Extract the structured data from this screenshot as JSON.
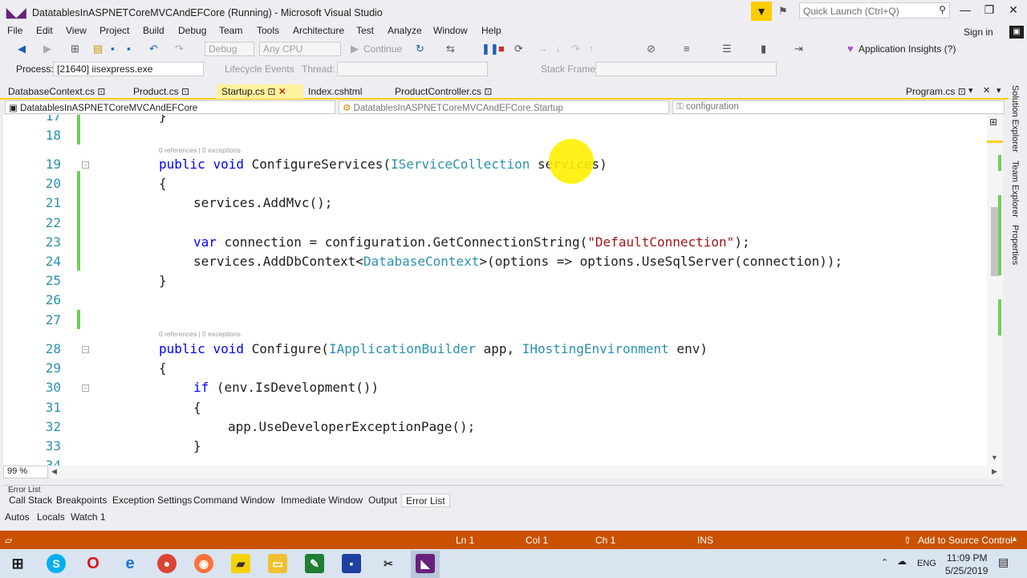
{
  "window": {
    "title": "DatatablesInASPNETCoreMVCAndEFCore (Running) - Microsoft Visual Studio",
    "quick_launch_placeholder": "Quick Launch (Ctrl+Q)",
    "minimize": "—",
    "maximize": "❐",
    "close": "✕"
  },
  "menu": {
    "items": [
      "File",
      "Edit",
      "View",
      "Project",
      "Build",
      "Debug",
      "Team",
      "Tools",
      "Architecture",
      "Test",
      "Analyze",
      "Window",
      "Help"
    ],
    "sign_in": "Sign in"
  },
  "toolbar": {
    "config": "Debug",
    "platform": "Any CPU",
    "continue": "Continue",
    "app_insights": "Application Insights (?)",
    "process_label": "Process:",
    "process_value": "[21640] iisexpress.exe",
    "lifecycle_events": "Lifecycle Events",
    "thread_label": "Thread:",
    "stack_frame_label": "Stack Frame:"
  },
  "tabs": [
    {
      "label": "DatabaseContext.cs",
      "pin": "⊡"
    },
    {
      "label": "Product.cs",
      "pin": "⊡"
    },
    {
      "label": "Startup.cs",
      "pin": "⊡"
    },
    {
      "label": "Index.cshtml",
      "pin": ""
    },
    {
      "label": "ProductController.cs",
      "pin": "⊡"
    },
    {
      "label": "Program.cs",
      "pin": "⊡"
    }
  ],
  "navbar": {
    "project": "DatatablesInASPNETCoreMVCAndEFCore",
    "class": "DatatablesInASPNETCoreMVCAndEFCore.Startup",
    "member": "configuration"
  },
  "editor": {
    "line_numbers": [
      "17",
      "18",
      "19",
      "20",
      "21",
      "22",
      "23",
      "24",
      "25",
      "26",
      "27",
      "28",
      "29",
      "30",
      "31",
      "32",
      "33",
      "34"
    ],
    "codelens": "0 references | 0 exceptions",
    "lines": {
      "l17": "}",
      "l19_kw1": "public",
      "l19_kw2": "void",
      "l19_name": "ConfigureServices(",
      "l19_type": "IServiceCollection",
      "l19_rest": " services)",
      "l20": "{",
      "l21": "services.AddMvc();",
      "l23_kw": "var",
      "l23_a": " connection = configuration.GetConnectionString(",
      "l23_str": "\"DefaultConnection\"",
      "l23_b": ");",
      "l24_a": "services.AddDbContext<",
      "l24_type": "DatabaseContext",
      "l24_b": ">(options => options.UseSqlServer(connection));",
      "l25": "}",
      "l28_kw1": "public",
      "l28_kw2": "void",
      "l28_name": "Configure(",
      "l28_type1": "IApplicationBuilder",
      "l28_mid": " app, ",
      "l28_type2": "IHostingEnvironment",
      "l28_rest": " env)",
      "l29": "{",
      "l30_kw": "if",
      "l30_rest": " (env.IsDevelopment())",
      "l31": "{",
      "l32": "app.UseDeveloperExceptionPage();",
      "l33": "}"
    },
    "zoom": "99 %"
  },
  "side_tabs": [
    "Solution Explorer",
    "Team Explorer",
    "Properties"
  ],
  "bottom_panel": {
    "title": "Error List",
    "tabs": [
      "Call Stack",
      "Breakpoints",
      "Exception Settings",
      "Command Window",
      "Immediate Window",
      "Output",
      "Error List"
    ],
    "watch_tabs": [
      "Autos",
      "Locals",
      "Watch 1"
    ]
  },
  "statusbar": {
    "ln": "Ln 1",
    "col": "Col 1",
    "ch": "Ch 1",
    "ins": "INS",
    "source_control": "Add to Source Control",
    "color": "#ca5100"
  },
  "taskbar": {
    "time": "11:09 PM",
    "date": "5/25/2019",
    "lang": "ENG"
  }
}
